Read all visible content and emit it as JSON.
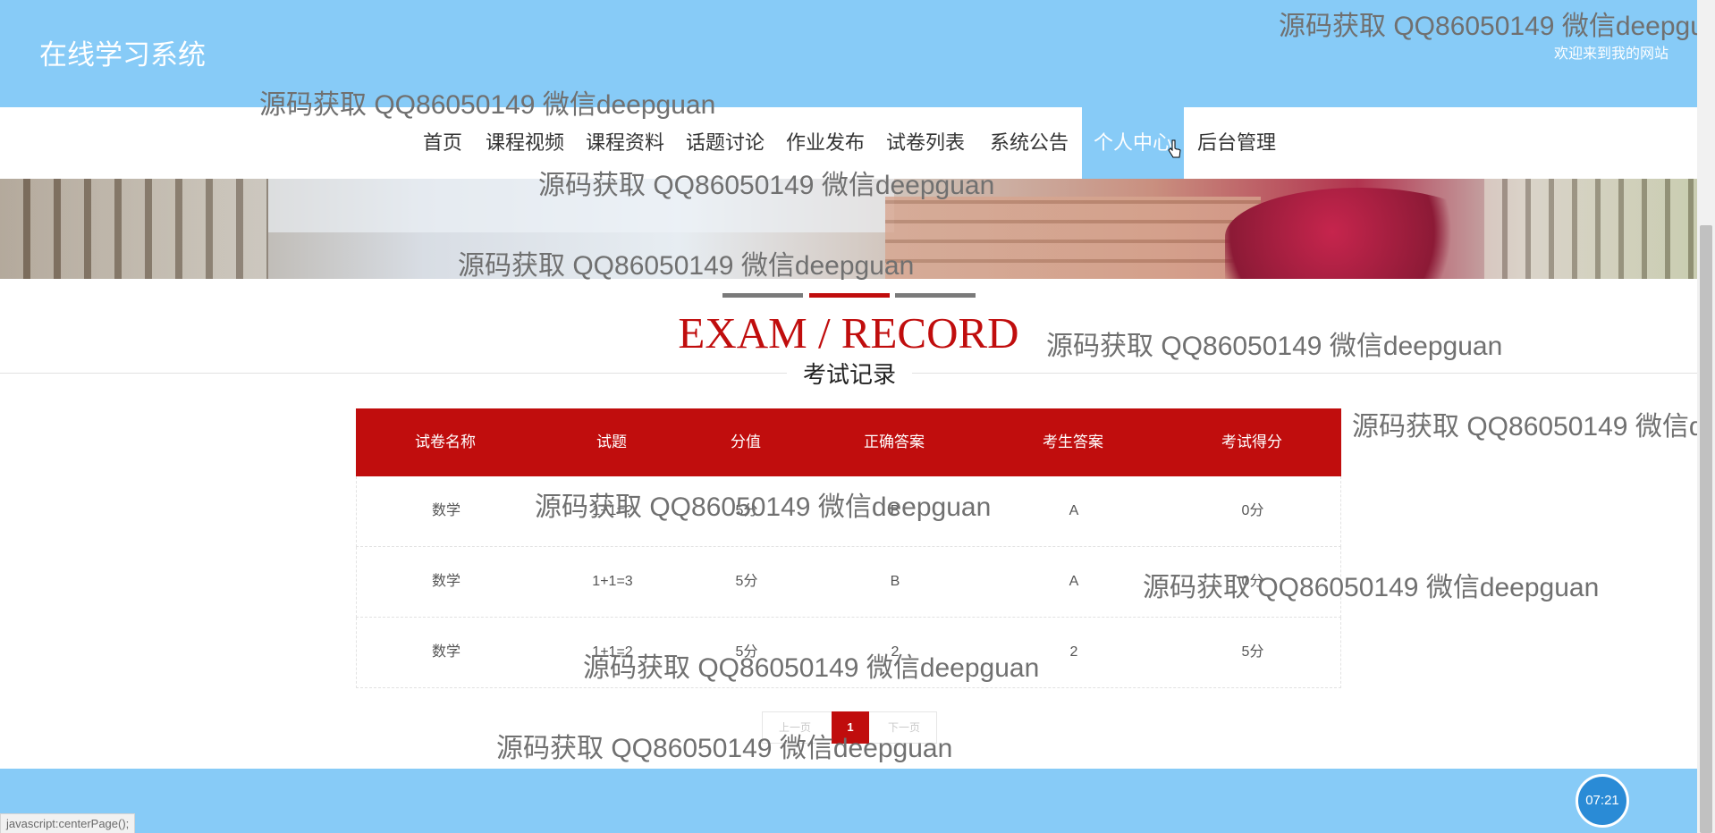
{
  "header": {
    "site_title": "在线学习系统",
    "welcome": "欢迎来到我的网站"
  },
  "nav": {
    "items": [
      {
        "label": "首页"
      },
      {
        "label": "课程视频"
      },
      {
        "label": "课程资料"
      },
      {
        "label": "话题讨论"
      },
      {
        "label": "作业发布"
      },
      {
        "label": "试卷列表"
      },
      {
        "label": "系统公告"
      },
      {
        "label": "个人中心",
        "active": true
      },
      {
        "label": "后台管理"
      }
    ]
  },
  "section": {
    "title_en": "EXAM / RECORD",
    "title_cn": "考试记录"
  },
  "table": {
    "headers": [
      "试卷名称",
      "试题",
      "分值",
      "正确答案",
      "考生答案",
      "考试得分"
    ],
    "rows": [
      [
        "数学",
        "1+1=?",
        "5分",
        "B",
        "A",
        "0分"
      ],
      [
        "数学",
        "1+1=3",
        "5分",
        "B",
        "A",
        "0分"
      ],
      [
        "数学",
        "1+1=2",
        "5分",
        "2",
        "2",
        "5分"
      ]
    ]
  },
  "pagination": {
    "prev": "上一页",
    "current": "1",
    "next": "下一页"
  },
  "footer": {
    "timer": "07:21"
  },
  "status_bar": {
    "text": "javascript:centerPage();"
  },
  "watermark": {
    "text": "源码获取 QQ86050149 微信deepguan"
  },
  "colors": {
    "header_bg": "#87cbf7",
    "accent_red": "#c00d0d",
    "nav_active_bg": "#87cbf7"
  }
}
